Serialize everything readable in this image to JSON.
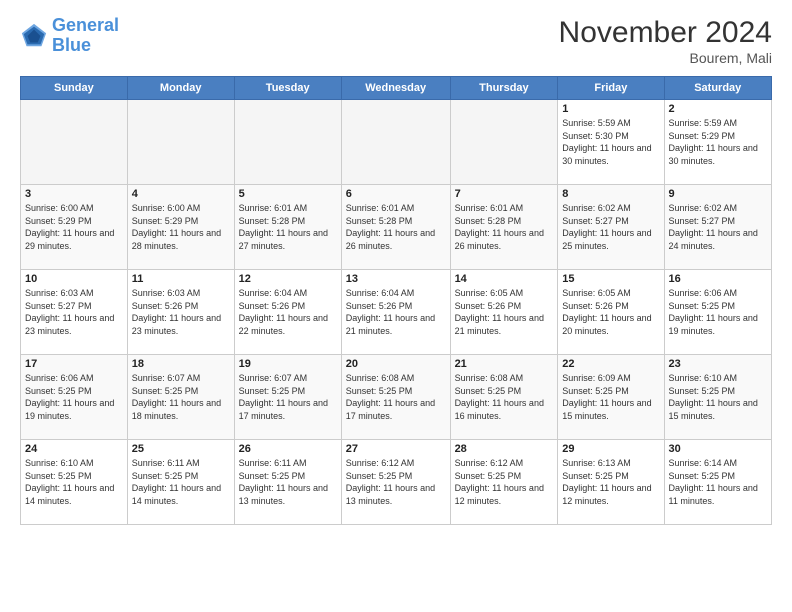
{
  "header": {
    "logo_general": "General",
    "logo_blue": "Blue",
    "month_title": "November 2024",
    "location": "Bourem, Mali"
  },
  "days_of_week": [
    "Sunday",
    "Monday",
    "Tuesday",
    "Wednesday",
    "Thursday",
    "Friday",
    "Saturday"
  ],
  "weeks": [
    [
      {
        "day": "",
        "empty": true
      },
      {
        "day": "",
        "empty": true
      },
      {
        "day": "",
        "empty": true
      },
      {
        "day": "",
        "empty": true
      },
      {
        "day": "",
        "empty": true
      },
      {
        "day": "1",
        "sunrise": "5:59 AM",
        "sunset": "5:30 PM",
        "daylight": "11 hours and 30 minutes."
      },
      {
        "day": "2",
        "sunrise": "5:59 AM",
        "sunset": "5:29 PM",
        "daylight": "11 hours and 30 minutes."
      }
    ],
    [
      {
        "day": "3",
        "sunrise": "6:00 AM",
        "sunset": "5:29 PM",
        "daylight": "11 hours and 29 minutes."
      },
      {
        "day": "4",
        "sunrise": "6:00 AM",
        "sunset": "5:29 PM",
        "daylight": "11 hours and 28 minutes."
      },
      {
        "day": "5",
        "sunrise": "6:01 AM",
        "sunset": "5:28 PM",
        "daylight": "11 hours and 27 minutes."
      },
      {
        "day": "6",
        "sunrise": "6:01 AM",
        "sunset": "5:28 PM",
        "daylight": "11 hours and 26 minutes."
      },
      {
        "day": "7",
        "sunrise": "6:01 AM",
        "sunset": "5:28 PM",
        "daylight": "11 hours and 26 minutes."
      },
      {
        "day": "8",
        "sunrise": "6:02 AM",
        "sunset": "5:27 PM",
        "daylight": "11 hours and 25 minutes."
      },
      {
        "day": "9",
        "sunrise": "6:02 AM",
        "sunset": "5:27 PM",
        "daylight": "11 hours and 24 minutes."
      }
    ],
    [
      {
        "day": "10",
        "sunrise": "6:03 AM",
        "sunset": "5:27 PM",
        "daylight": "11 hours and 23 minutes."
      },
      {
        "day": "11",
        "sunrise": "6:03 AM",
        "sunset": "5:26 PM",
        "daylight": "11 hours and 23 minutes."
      },
      {
        "day": "12",
        "sunrise": "6:04 AM",
        "sunset": "5:26 PM",
        "daylight": "11 hours and 22 minutes."
      },
      {
        "day": "13",
        "sunrise": "6:04 AM",
        "sunset": "5:26 PM",
        "daylight": "11 hours and 21 minutes."
      },
      {
        "day": "14",
        "sunrise": "6:05 AM",
        "sunset": "5:26 PM",
        "daylight": "11 hours and 21 minutes."
      },
      {
        "day": "15",
        "sunrise": "6:05 AM",
        "sunset": "5:26 PM",
        "daylight": "11 hours and 20 minutes."
      },
      {
        "day": "16",
        "sunrise": "6:06 AM",
        "sunset": "5:25 PM",
        "daylight": "11 hours and 19 minutes."
      }
    ],
    [
      {
        "day": "17",
        "sunrise": "6:06 AM",
        "sunset": "5:25 PM",
        "daylight": "11 hours and 19 minutes."
      },
      {
        "day": "18",
        "sunrise": "6:07 AM",
        "sunset": "5:25 PM",
        "daylight": "11 hours and 18 minutes."
      },
      {
        "day": "19",
        "sunrise": "6:07 AM",
        "sunset": "5:25 PM",
        "daylight": "11 hours and 17 minutes."
      },
      {
        "day": "20",
        "sunrise": "6:08 AM",
        "sunset": "5:25 PM",
        "daylight": "11 hours and 17 minutes."
      },
      {
        "day": "21",
        "sunrise": "6:08 AM",
        "sunset": "5:25 PM",
        "daylight": "11 hours and 16 minutes."
      },
      {
        "day": "22",
        "sunrise": "6:09 AM",
        "sunset": "5:25 PM",
        "daylight": "11 hours and 15 minutes."
      },
      {
        "day": "23",
        "sunrise": "6:10 AM",
        "sunset": "5:25 PM",
        "daylight": "11 hours and 15 minutes."
      }
    ],
    [
      {
        "day": "24",
        "sunrise": "6:10 AM",
        "sunset": "5:25 PM",
        "daylight": "11 hours and 14 minutes."
      },
      {
        "day": "25",
        "sunrise": "6:11 AM",
        "sunset": "5:25 PM",
        "daylight": "11 hours and 14 minutes."
      },
      {
        "day": "26",
        "sunrise": "6:11 AM",
        "sunset": "5:25 PM",
        "daylight": "11 hours and 13 minutes."
      },
      {
        "day": "27",
        "sunrise": "6:12 AM",
        "sunset": "5:25 PM",
        "daylight": "11 hours and 13 minutes."
      },
      {
        "day": "28",
        "sunrise": "6:12 AM",
        "sunset": "5:25 PM",
        "daylight": "11 hours and 12 minutes."
      },
      {
        "day": "29",
        "sunrise": "6:13 AM",
        "sunset": "5:25 PM",
        "daylight": "11 hours and 12 minutes."
      },
      {
        "day": "30",
        "sunrise": "6:14 AM",
        "sunset": "5:25 PM",
        "daylight": "11 hours and 11 minutes."
      }
    ]
  ],
  "labels": {
    "sunrise": "Sunrise:",
    "sunset": "Sunset:",
    "daylight": "Daylight:"
  }
}
